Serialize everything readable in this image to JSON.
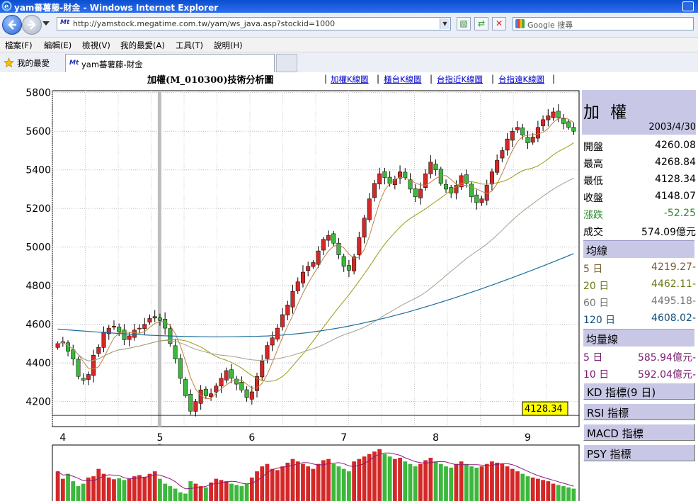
{
  "window": {
    "title": "yam蕃薯藤-財金 - Windows Internet Explorer"
  },
  "address": {
    "url": "http://yamstock.megatime.com.tw/yam/ws_java.asp?stockid=1000",
    "page_icon": "Mt"
  },
  "search": {
    "placeholder": "Google 搜尋"
  },
  "menu": [
    "檔案(F)",
    "編輯(E)",
    "檢視(V)",
    "我的最愛(A)",
    "工具(T)",
    "說明(H)"
  ],
  "favorites": {
    "label": "我的最愛",
    "tab_title": "yam蕃薯藤-財金"
  },
  "page": {
    "title": "加權(M_010300)技術分析圖",
    "links": [
      "加權K線圖",
      "櫃台K線圖",
      "台指近K線圖",
      "台指遠K線圖"
    ]
  },
  "panel": {
    "name": "加 權",
    "date": "2003/4/30",
    "quote": [
      {
        "label": "開盤",
        "value": "4260.08",
        "color": "#000000"
      },
      {
        "label": "最高",
        "value": "4268.84",
        "color": "#000000"
      },
      {
        "label": "最低",
        "value": "4128.34",
        "color": "#000000"
      },
      {
        "label": "收盤",
        "value": "4148.07",
        "color": "#000000"
      },
      {
        "label": "漲跌",
        "value": "-52.25",
        "color": "#2e8b2e"
      },
      {
        "label": "成交",
        "value": "574.09億元",
        "color": "#000000"
      }
    ],
    "ma_header": "均線",
    "ma": [
      {
        "label": "5 日",
        "value": "4219.27-",
        "color": "#7a5c32"
      },
      {
        "label": "20 日",
        "value": "4462.11-",
        "color": "#6e7a12"
      },
      {
        "label": "60 日",
        "value": "4495.18-",
        "color": "#777777"
      },
      {
        "label": "120 日",
        "value": "4608.02-",
        "color": "#134f7a"
      }
    ],
    "vol_header": "均量線",
    "vol_ma": [
      {
        "label": "5 日",
        "value": "585.94億元-",
        "color": "#7a1b6e"
      },
      {
        "label": "10 日",
        "value": "592.04億元-",
        "color": "#7a1b6e"
      }
    ],
    "buttons": [
      "KD 指標(9 日)",
      "RSI 指標",
      "MACD 指標",
      "PSY 指標"
    ]
  },
  "chart_data": {
    "type": "candlestick",
    "title": "加權(M_010300)技術分析圖",
    "x_ticks": [
      "4",
      "5",
      "6",
      "7",
      "8",
      "9"
    ],
    "y_ticks": [
      4200,
      4400,
      4600,
      4800,
      5000,
      5200,
      5400,
      5600,
      5800
    ],
    "ylim": [
      4070,
      5810
    ],
    "cursor_value_label": "4128.34",
    "colors": {
      "up": "#d42828",
      "down": "#3cb83c",
      "ma5": "#c08040",
      "ma20": "#9a9a14",
      "ma60": "#a0a090",
      "ma120": "#1c6e9a",
      "vol_ma": "#8a1a7a"
    },
    "close": [
      4500,
      4510,
      4460,
      4420,
      4330,
      4310,
      4340,
      4440,
      4480,
      4560,
      4580,
      4590,
      4560,
      4520,
      4540,
      4570,
      4580,
      4600,
      4630,
      4640,
      4620,
      4580,
      4500,
      4420,
      4320,
      4230,
      4150,
      4200,
      4260,
      4230,
      4240,
      4280,
      4320,
      4360,
      4320,
      4290,
      4260,
      4220,
      4250,
      4330,
      4410,
      4490,
      4530,
      4580,
      4650,
      4700,
      4770,
      4820,
      4870,
      4900,
      4920,
      4980,
      5040,
      5060,
      5020,
      4960,
      4900,
      4880,
      4950,
      5050,
      5150,
      5250,
      5330,
      5380,
      5360,
      5330,
      5350,
      5390,
      5360,
      5300,
      5260,
      5300,
      5380,
      5440,
      5400,
      5330,
      5300,
      5280,
      5320,
      5370,
      5330,
      5260,
      5230,
      5250,
      5320,
      5390,
      5450,
      5500,
      5560,
      5600,
      5620,
      5580,
      5540,
      5570,
      5620,
      5660,
      5680,
      5700,
      5670,
      5640,
      5620,
      5600
    ],
    "volume": [
      120,
      90,
      110,
      80,
      60,
      70,
      95,
      100,
      130,
      110,
      95,
      88,
      92,
      85,
      90,
      100,
      105,
      98,
      110,
      120,
      90,
      70,
      60,
      50,
      35,
      30,
      80,
      70,
      60,
      55,
      75,
      90,
      85,
      80,
      70,
      65,
      60,
      70,
      95,
      120,
      140,
      150,
      130,
      125,
      140,
      155,
      170,
      160,
      150,
      140,
      130,
      150,
      165,
      170,
      150,
      140,
      130,
      120,
      160,
      170,
      180,
      190,
      200,
      210,
      190,
      180,
      170,
      175,
      160,
      150,
      140,
      150,
      165,
      175,
      160,
      150,
      140,
      135,
      150,
      160,
      150,
      140,
      135,
      140,
      150,
      160,
      155,
      150,
      140,
      130,
      120,
      110,
      100,
      95,
      90,
      85,
      80,
      70,
      65,
      60,
      55,
      50
    ]
  }
}
